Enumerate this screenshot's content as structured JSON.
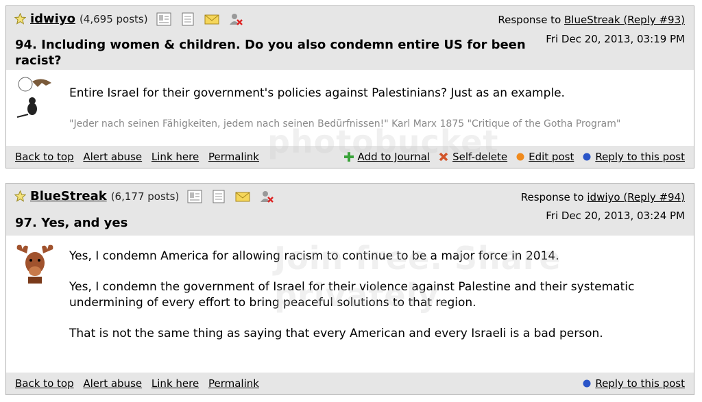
{
  "posts": [
    {
      "username": "idwiyo",
      "post_count": "(4,695 posts)",
      "response_prefix": "Response to ",
      "response_link": "BlueStreak (Reply #93)",
      "date": "Fri Dec 20, 2013, 03:19 PM",
      "title": "94. Including women & children. Do you also condemn entire US for been racist?",
      "paragraphs": [
        "Entire Israel for their government's policies against Palestinians? Just as an example."
      ],
      "signature": "\"Jeder nach seinen Fähigkeiten, jedem nach seinen Bedürfnissen!\" Karl Marx 1875 \"Critique of the Gotha Program\"",
      "footer_left": [
        "Back to top",
        "Alert abuse",
        "Link here",
        "Permalink"
      ],
      "footer_right": [
        "Add to Journal",
        "Self-delete",
        "Edit post",
        "Reply to this post"
      ]
    },
    {
      "username": "BlueStreak",
      "post_count": "(6,177 posts)",
      "response_prefix": "Response to ",
      "response_link": "idwiyo (Reply #94)",
      "date": "Fri Dec 20, 2013, 03:24 PM",
      "title": "97. Yes, and yes",
      "paragraphs": [
        "Yes, I condemn America for allowing racism to continue to be a major force in 2014.",
        "Yes, I condemn the government of Israel for their violence against Palestine and their systematic undermining of every effort to bring peaceful solutions to that region.",
        "That is not the same thing as saying that every American and every Israeli is a bad person."
      ],
      "footer_left": [
        "Back to top",
        "Alert abuse",
        "Link here",
        "Permalink"
      ],
      "footer_right": [
        "Reply to this post"
      ]
    }
  ],
  "watermark": {
    "line1": "photobucket",
    "line2": "Join free. Share privately."
  },
  "colors": {
    "header_bg": "#e6e6e6",
    "add_journal": "#3aa33a",
    "self_delete": "#d2552a",
    "edit_post": "#f08a1c",
    "reply": "#2a55c8"
  }
}
